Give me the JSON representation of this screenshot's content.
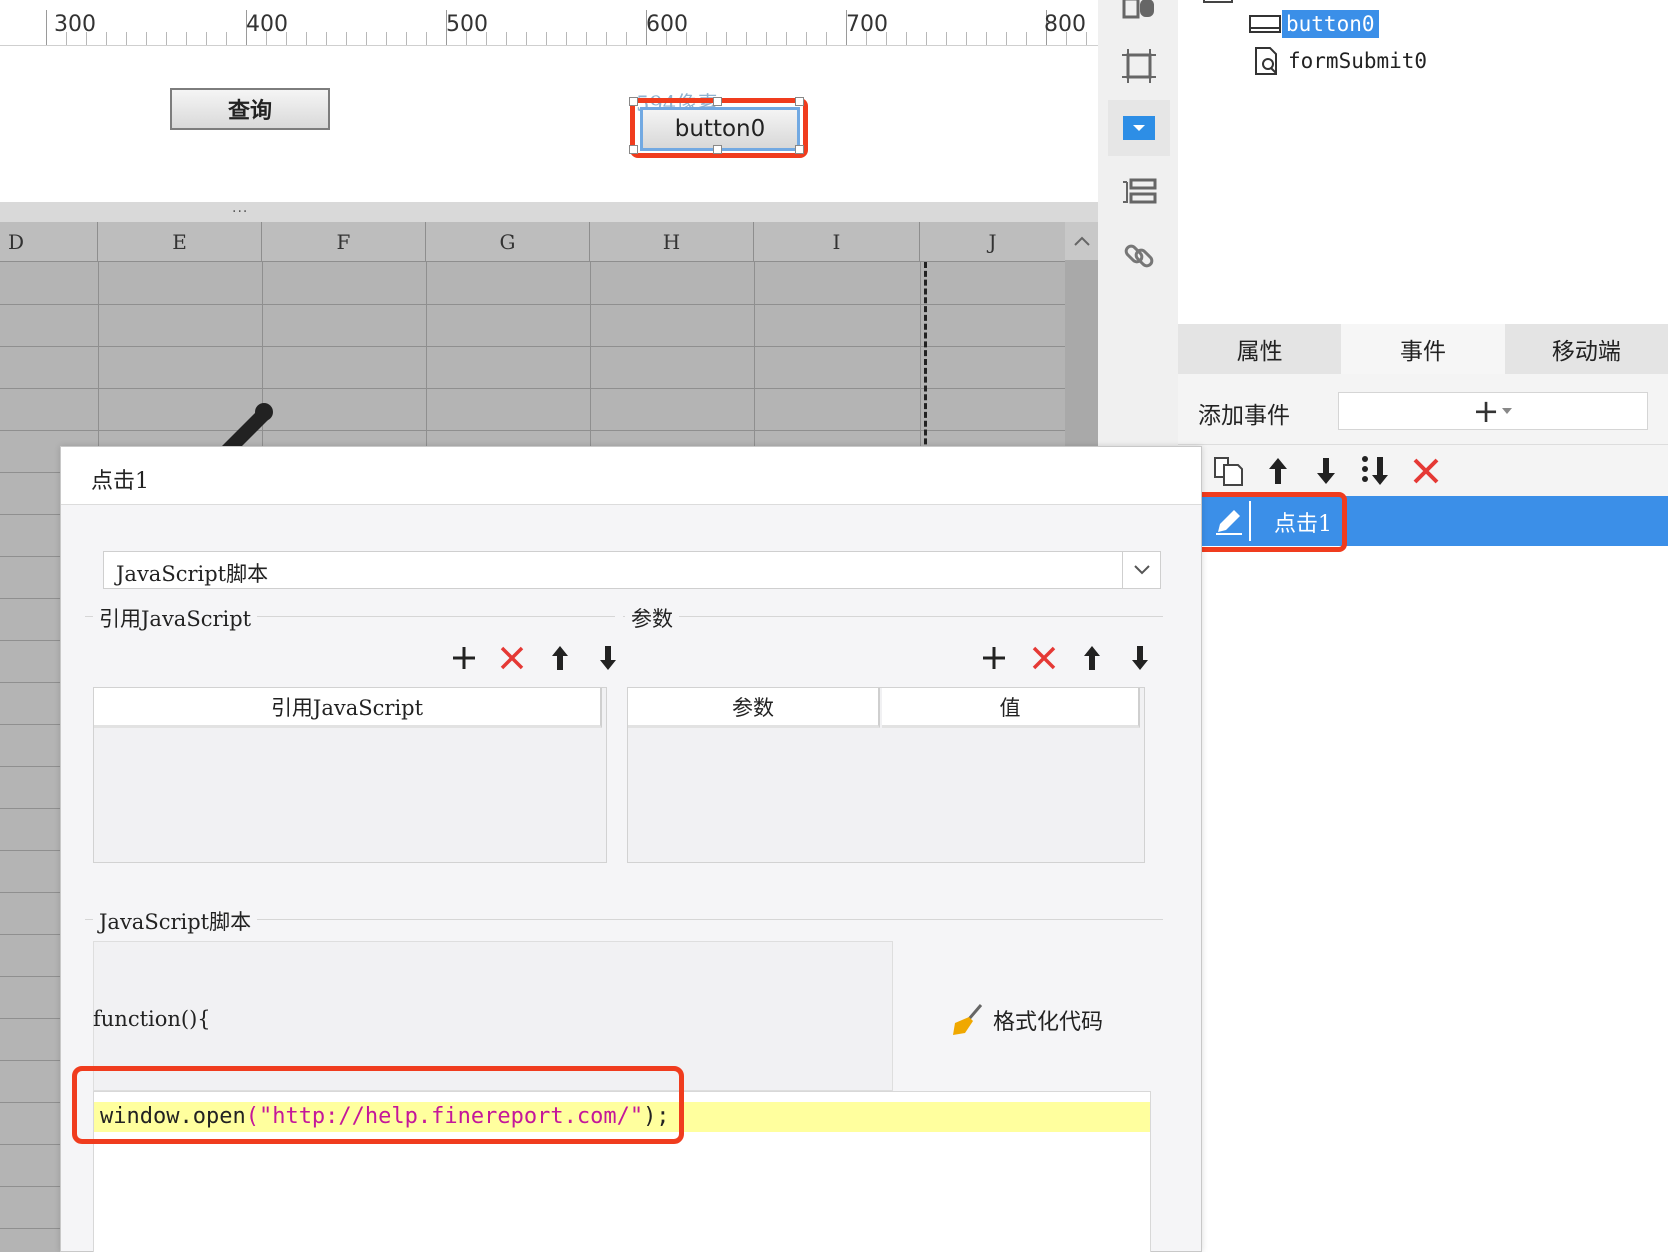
{
  "ruler": {
    "labels": [
      "300",
      "400",
      "500",
      "600",
      "700",
      "800"
    ]
  },
  "design": {
    "pixel_hint": "594像素",
    "query_button": "查询",
    "selected_button": "button0",
    "collapse_dots": "..."
  },
  "sheet": {
    "columns": [
      "D",
      "E",
      "F",
      "G",
      "H",
      "I",
      "J"
    ]
  },
  "vtoolbar": {
    "icons": [
      "widget-icon",
      "frame-icon",
      "dropdown-icon",
      "layout-icon",
      "link-icon"
    ]
  },
  "tree": {
    "button0": "button0",
    "form_submit": "formSubmit0"
  },
  "panel": {
    "tabs": [
      "属性",
      "事件",
      "移动端"
    ],
    "active_tab": "事件",
    "add_event_label": "添加事件",
    "add_event_button": "+",
    "event_item": "点击1"
  },
  "dialog": {
    "title": "点击1",
    "type_value": "JavaScript脚本",
    "ref_js_section": "引用JavaScript",
    "params_section": "参数",
    "ref_js_header": "引用JavaScript",
    "param_header": "参数",
    "value_header": "值",
    "script_section": "JavaScript脚本",
    "function_head": "function(){",
    "format_code": "格式化代码",
    "code": {
      "fn": "window.open",
      "open_paren": "(",
      "str": "\"http://help.finereport.com/\"",
      "close": ");"
    }
  },
  "colors": {
    "accent": "#3b8fe8",
    "highlight": "#f03c1e",
    "delete": "#e53935",
    "code_line_bg": "#ffff9e"
  }
}
